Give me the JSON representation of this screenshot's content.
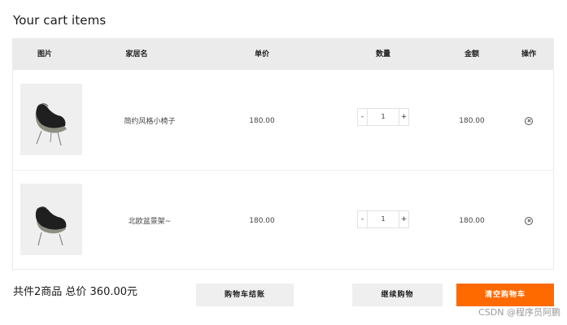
{
  "page": {
    "title": "Your cart items"
  },
  "table": {
    "headers": [
      "图片",
      "家居名",
      "单价",
      "数量",
      "金额",
      "操作"
    ],
    "rows": [
      {
        "name": "简约风格小椅子",
        "price": "180.00",
        "qty": "1",
        "amount": "180.00"
      },
      {
        "name": "北欧盆景架~",
        "price": "180.00",
        "qty": "1",
        "amount": "180.00"
      }
    ],
    "stepper": {
      "minus": "-",
      "plus": "+"
    }
  },
  "summary": {
    "text": "共件2商品 总价 360.00元"
  },
  "buttons": {
    "checkout": "购物车结账",
    "continue": "继续购物",
    "clear": "清空购物车"
  },
  "watermark": "CSDN @程序员阿鹏",
  "colors": {
    "accent": "#ff6a00",
    "header_bg": "#ebebeb",
    "button_bg": "#efefef"
  }
}
